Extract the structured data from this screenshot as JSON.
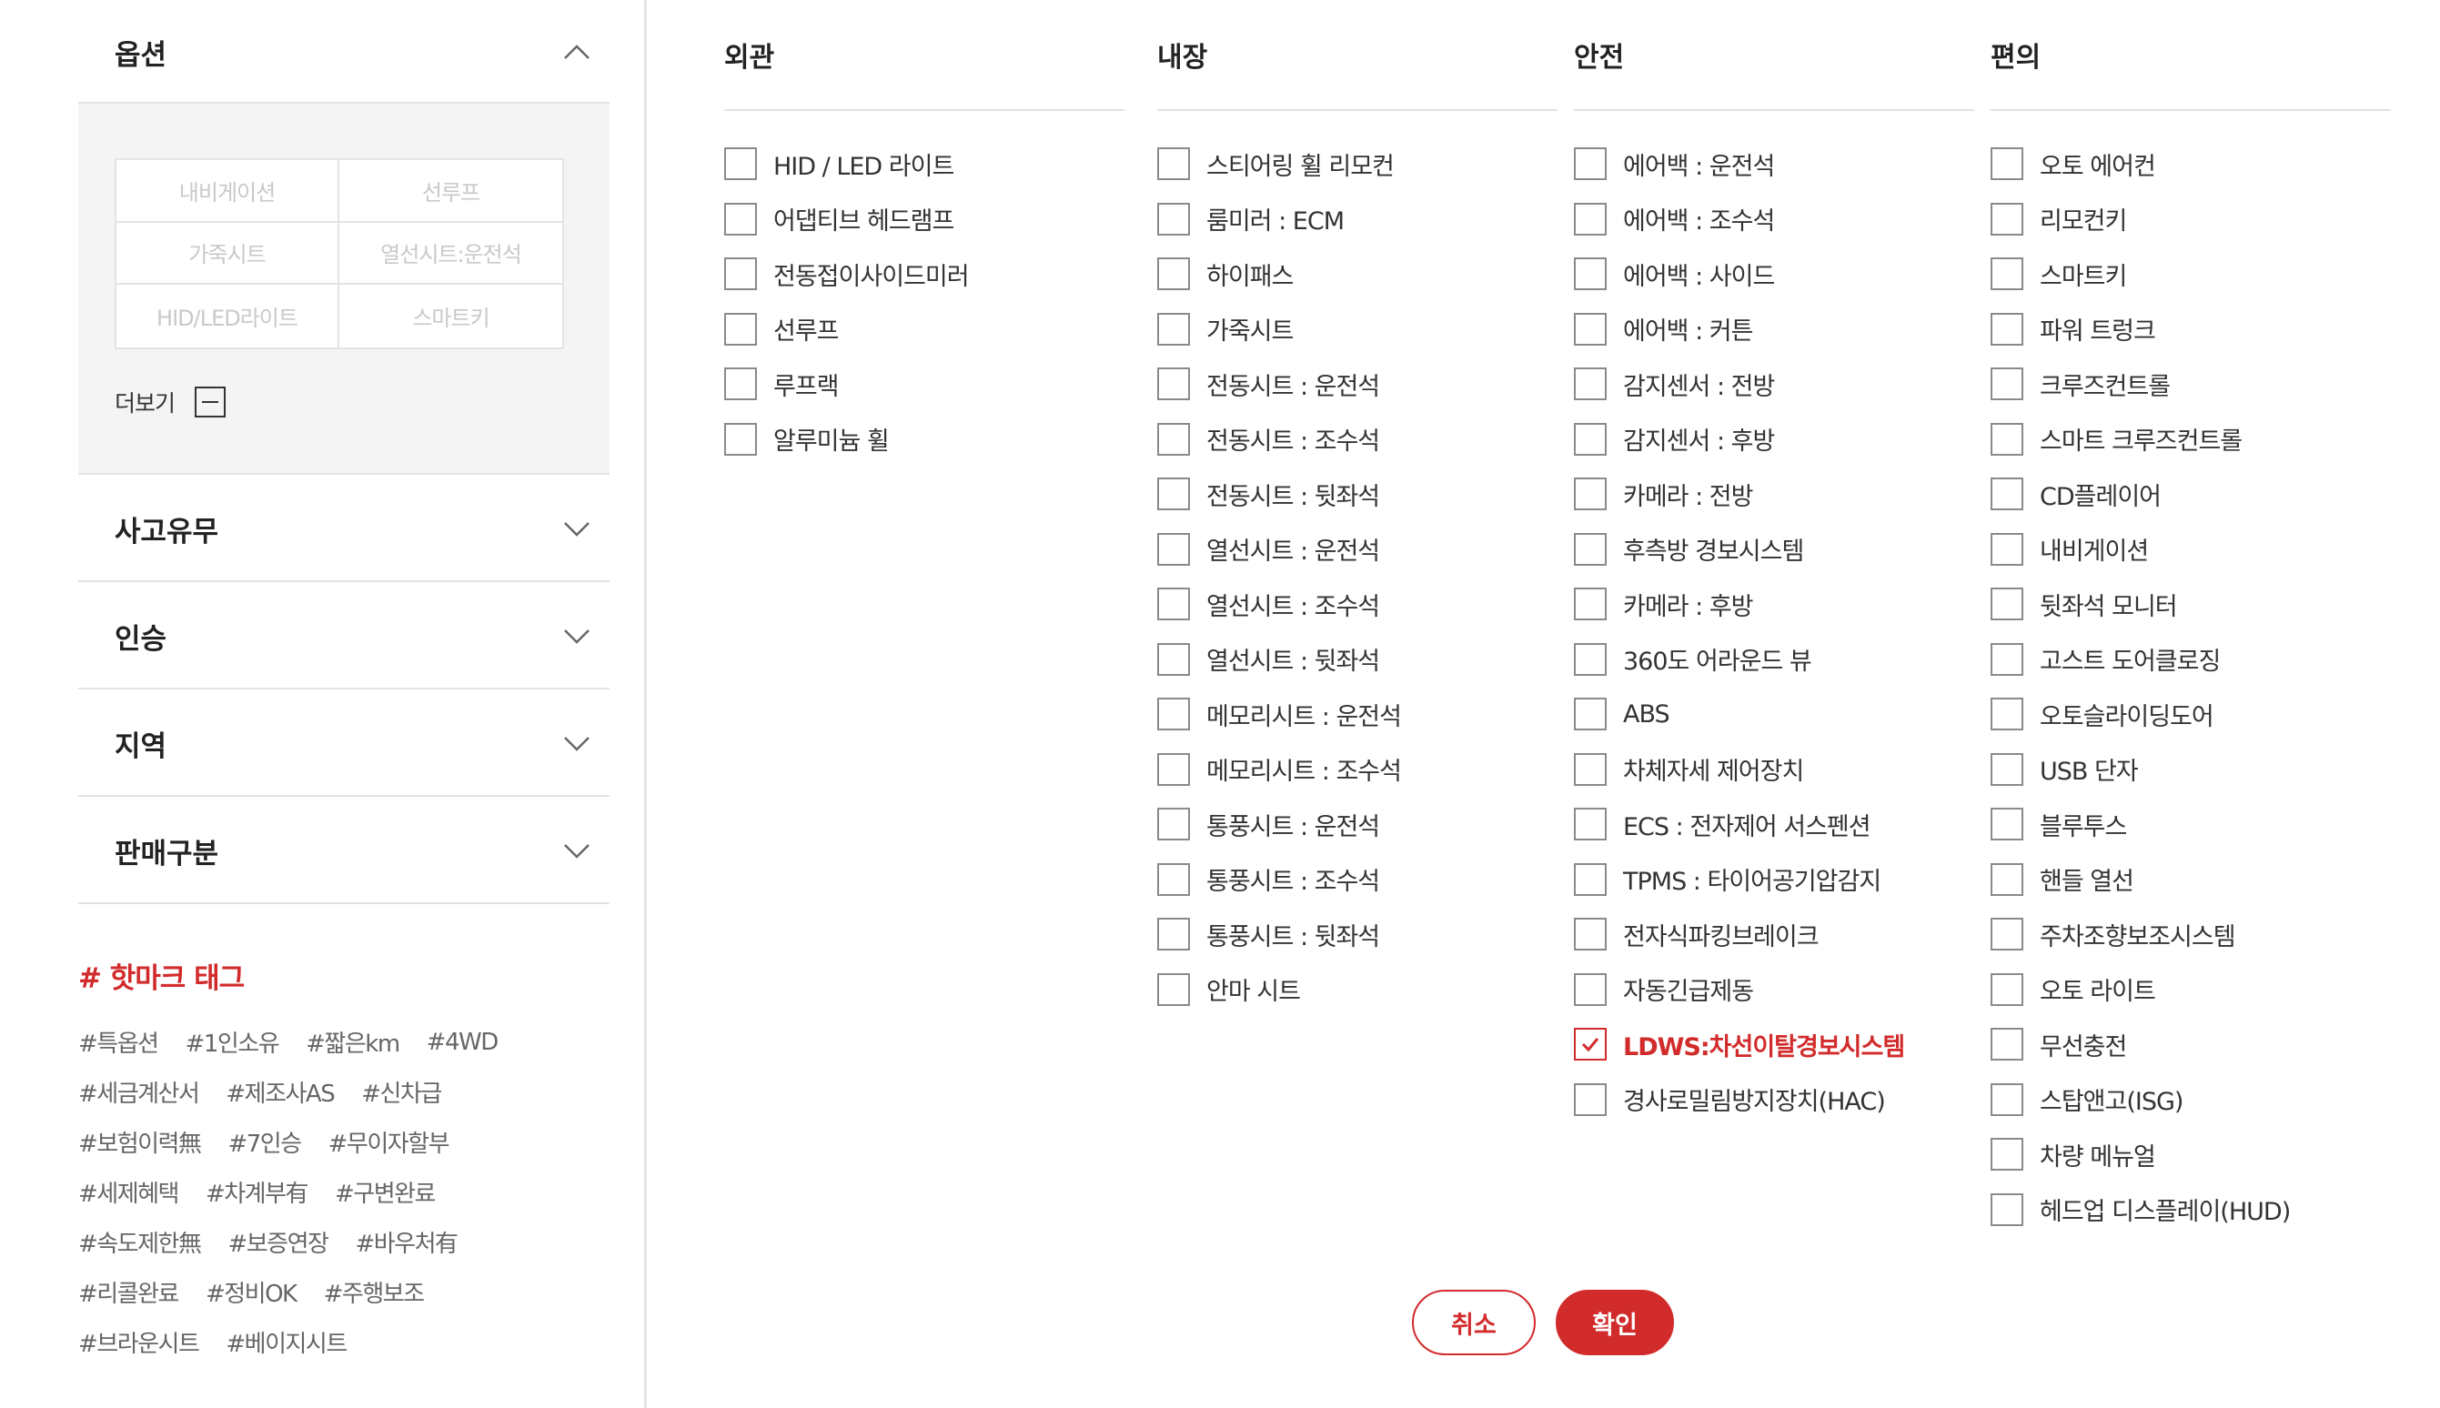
{
  "sidebar": {
    "sections": [
      {
        "title": "옵션",
        "expanded": true
      },
      {
        "title": "사고유무",
        "expanded": false
      },
      {
        "title": "인승",
        "expanded": false
      },
      {
        "title": "지역",
        "expanded": false
      },
      {
        "title": "판매구분",
        "expanded": false
      }
    ],
    "option_grid": [
      "내비게이션",
      "선루프",
      "가죽시트",
      "열선시트:운전석",
      "HID/LED라이트",
      "스마트키"
    ],
    "more_label": "더보기",
    "hot_tags_title": "# 핫마크 태그",
    "tag_rows": [
      [
        "#특옵션",
        "#1인소유",
        "#짧은km",
        "#4WD"
      ],
      [
        "#세금계산서",
        "#제조사AS",
        "#신차급"
      ],
      [
        "#보험이력無",
        "#7인승",
        "#무이자할부"
      ],
      [
        "#세제혜택",
        "#차계부有",
        "#구변완료"
      ],
      [
        "#속도제한無",
        "#보증연장",
        "#바우처有"
      ],
      [
        "#리콜완료",
        "#정비OK",
        "#주행보조"
      ],
      [
        "#브라운시트",
        "#베이지시트"
      ]
    ]
  },
  "columns": [
    {
      "title": "외관",
      "items": [
        {
          "label": "HID / LED 라이트",
          "checked": false
        },
        {
          "label": "어댑티브 헤드램프",
          "checked": false
        },
        {
          "label": "전동접이사이드미러",
          "checked": false
        },
        {
          "label": "선루프",
          "checked": false
        },
        {
          "label": "루프랙",
          "checked": false
        },
        {
          "label": "알루미늄 휠",
          "checked": false
        }
      ]
    },
    {
      "title": "내장",
      "items": [
        {
          "label": "스티어링 휠 리모컨",
          "checked": false
        },
        {
          "label": "룸미러 : ECM",
          "checked": false
        },
        {
          "label": "하이패스",
          "checked": false
        },
        {
          "label": "가죽시트",
          "checked": false
        },
        {
          "label": "전동시트 : 운전석",
          "checked": false
        },
        {
          "label": "전동시트 : 조수석",
          "checked": false
        },
        {
          "label": "전동시트 : 뒷좌석",
          "checked": false
        },
        {
          "label": "열선시트 : 운전석",
          "checked": false
        },
        {
          "label": "열선시트 : 조수석",
          "checked": false
        },
        {
          "label": "열선시트 : 뒷좌석",
          "checked": false
        },
        {
          "label": "메모리시트 : 운전석",
          "checked": false
        },
        {
          "label": "메모리시트 : 조수석",
          "checked": false
        },
        {
          "label": "통풍시트 : 운전석",
          "checked": false
        },
        {
          "label": "통풍시트 : 조수석",
          "checked": false
        },
        {
          "label": "통풍시트 : 뒷좌석",
          "checked": false
        },
        {
          "label": "안마 시트",
          "checked": false
        }
      ]
    },
    {
      "title": "안전",
      "items": [
        {
          "label": "에어백 : 운전석",
          "checked": false
        },
        {
          "label": "에어백 : 조수석",
          "checked": false
        },
        {
          "label": "에어백 : 사이드",
          "checked": false
        },
        {
          "label": "에어백 : 커튼",
          "checked": false
        },
        {
          "label": "감지센서 : 전방",
          "checked": false
        },
        {
          "label": "감지센서 : 후방",
          "checked": false
        },
        {
          "label": "카메라 : 전방",
          "checked": false
        },
        {
          "label": "후측방 경보시스템",
          "checked": false
        },
        {
          "label": "카메라 : 후방",
          "checked": false
        },
        {
          "label": "360도 어라운드 뷰",
          "checked": false
        },
        {
          "label": "ABS",
          "checked": false
        },
        {
          "label": "차체자세 제어장치",
          "checked": false
        },
        {
          "label": "ECS : 전자제어 서스펜션",
          "checked": false
        },
        {
          "label": "TPMS : 타이어공기압감지",
          "checked": false
        },
        {
          "label": "전자식파킹브레이크",
          "checked": false
        },
        {
          "label": "자동긴급제동",
          "checked": false
        },
        {
          "label": "LDWS:차선이탈경보시스템",
          "checked": true
        },
        {
          "label": "경사로밀림방지장치(HAC)",
          "checked": false
        }
      ]
    },
    {
      "title": "편의",
      "items": [
        {
          "label": "오토 에어컨",
          "checked": false
        },
        {
          "label": "리모컨키",
          "checked": false
        },
        {
          "label": "스마트키",
          "checked": false
        },
        {
          "label": "파워 트렁크",
          "checked": false
        },
        {
          "label": "크루즈컨트롤",
          "checked": false
        },
        {
          "label": "스마트 크루즈컨트롤",
          "checked": false
        },
        {
          "label": "CD플레이어",
          "checked": false
        },
        {
          "label": "내비게이션",
          "checked": false
        },
        {
          "label": "뒷좌석 모니터",
          "checked": false
        },
        {
          "label": "고스트 도어클로징",
          "checked": false
        },
        {
          "label": "오토슬라이딩도어",
          "checked": false
        },
        {
          "label": "USB 단자",
          "checked": false
        },
        {
          "label": "블루투스",
          "checked": false
        },
        {
          "label": "핸들 열선",
          "checked": false
        },
        {
          "label": "주차조향보조시스템",
          "checked": false
        },
        {
          "label": "오토 라이트",
          "checked": false
        },
        {
          "label": "무선충전",
          "checked": false
        },
        {
          "label": "스탑앤고(ISG)",
          "checked": false
        },
        {
          "label": "차량 메뉴얼",
          "checked": false
        },
        {
          "label": "헤드업 디스플레이(HUD)",
          "checked": false
        }
      ]
    }
  ],
  "buttons": {
    "cancel": "취소",
    "confirm": "확인"
  },
  "colors": {
    "accent": "#d22b2b",
    "divider": "#e2e2e2",
    "panel_bg": "#f4f4f4"
  }
}
